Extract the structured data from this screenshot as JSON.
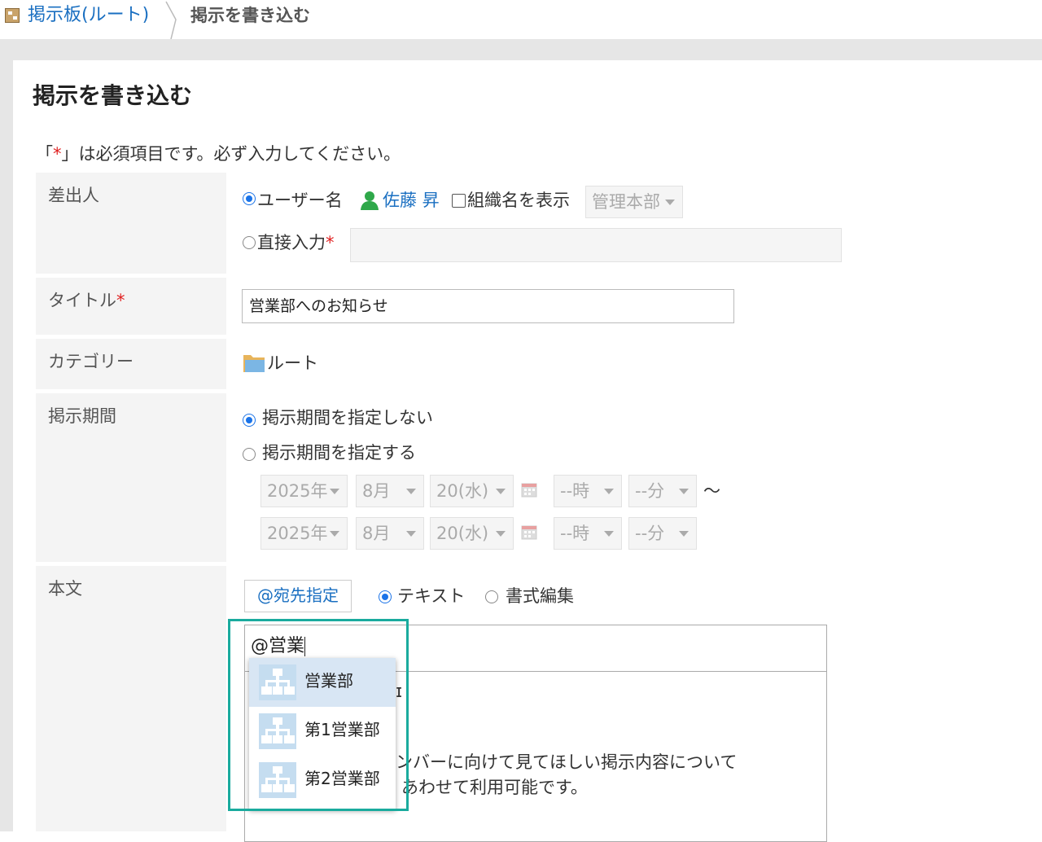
{
  "breadcrumb": {
    "root": "掲示板(ルート)",
    "current": "掲示を書き込む"
  },
  "page": {
    "title": "掲示を書き込む",
    "required_note_prefix": "「",
    "required_mark": "*",
    "required_note_suffix": "」は必須項目です。必ず入力してください。"
  },
  "sender": {
    "label": "差出人",
    "username_option": "ユーザー名",
    "user_name": "佐藤 昇",
    "show_org": "組織名を表示",
    "org_select": "管理本部",
    "direct_input": "直接入力",
    "direct_input_value": ""
  },
  "title_field": {
    "label": "タイトル",
    "value": "営業部へのお知らせ"
  },
  "category": {
    "label": "カテゴリー",
    "value": "ルート"
  },
  "period": {
    "label": "掲示期間",
    "no_period": "掲示期間を指定しない",
    "set_period": "掲示期間を指定する",
    "start": {
      "year": "2025年",
      "month": "8月",
      "day": "20(水)",
      "hour": "--時",
      "minute": "--分"
    },
    "end": {
      "year": "2025年",
      "month": "8月",
      "day": "20(水)",
      "hour": "--時",
      "minute": "--分"
    },
    "tilde": "〜"
  },
  "body": {
    "label": "本文",
    "mention_button": "@宛先指定",
    "mode_text": "テキスト",
    "mode_rich": "書式編集",
    "mention_input": "@営業",
    "visible_text_line1": "ɪ",
    "visible_text_line2": "ンバーに向けて見てほしい掲示内容について",
    "visible_text_line3": "あわせて利用可能です。"
  },
  "suggestions": [
    "営業部",
    "第1営業部",
    "第2営業部"
  ],
  "colors": {
    "link": "#1a6fc1",
    "required": "#e02020",
    "highlight": "#1aab9e",
    "selected_row": "#d8e6f4"
  }
}
